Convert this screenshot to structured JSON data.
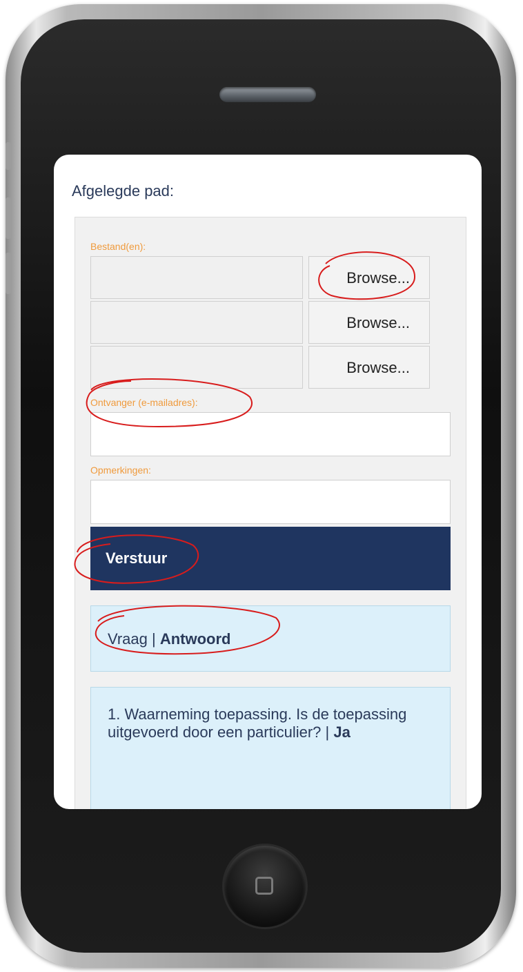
{
  "form": {
    "heading": "Afgelegde pad:",
    "files_label": "Bestand(en):",
    "browse_labels": [
      "Browse...",
      "Browse...",
      "Browse..."
    ],
    "recipient_label": "Ontvanger (e-mailadres):",
    "recipient_value": "",
    "remarks_label": "Opmerkingen:",
    "remarks_value": "",
    "submit_label": "Verstuur"
  },
  "qa_header": {
    "question": "Vraag",
    "separator": " | ",
    "answer": "Antwoord"
  },
  "answers": [
    {
      "question": "1. Waarneming toepassing. Is de toepassing uitgevoerd door een particulier?",
      "separator": " | ",
      "answer": "Ja"
    }
  ],
  "colors": {
    "label_orange": "#f09a3c",
    "submit_navy": "#1f3560",
    "info_blue": "#dcf0fa",
    "annotation_red": "#d81c1c"
  },
  "icons": {
    "home_button": "home-square-icon",
    "speaker": "speaker-grille"
  }
}
